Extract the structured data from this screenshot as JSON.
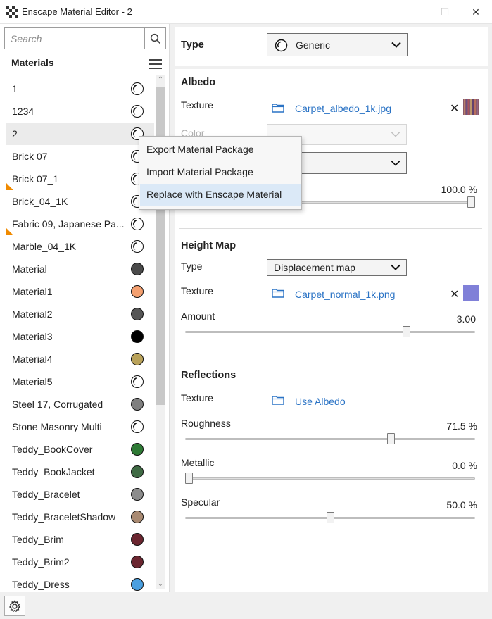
{
  "window": {
    "title": "Enscape Material Editor - 2",
    "minimize_glyph": "—",
    "maximize_glyph": "☐",
    "close_glyph": "✕"
  },
  "sidebar": {
    "search_placeholder": "Search",
    "header": "Materials",
    "items": [
      {
        "label": "1",
        "swatch": "generic"
      },
      {
        "label": "1234",
        "swatch": "generic"
      },
      {
        "label": "2",
        "swatch": "generic",
        "selected": true
      },
      {
        "label": "Brick 07",
        "swatch": "generic"
      },
      {
        "label": "Brick 07_1",
        "swatch": "generic",
        "warning": true
      },
      {
        "label": "Brick_04_1K",
        "swatch": "generic"
      },
      {
        "label": "Fabric 09, Japanese Pa...",
        "swatch": "generic",
        "warning": true
      },
      {
        "label": "Marble_04_1K",
        "swatch": "generic"
      },
      {
        "label": "Material",
        "swatch": "#4a4a4a"
      },
      {
        "label": "Material1",
        "swatch": "#f4a070"
      },
      {
        "label": "Material2",
        "swatch": "#555555"
      },
      {
        "label": "Material3",
        "swatch": "#000000"
      },
      {
        "label": "Material4",
        "swatch": "#b9a25a"
      },
      {
        "label": "Material5",
        "swatch": "generic"
      },
      {
        "label": "Steel 17, Corrugated",
        "swatch": "#7f7f7f"
      },
      {
        "label": "Stone Masonry Multi",
        "swatch": "generic"
      },
      {
        "label": "Teddy_BookCover",
        "swatch": "#2e7a35"
      },
      {
        "label": "Teddy_BookJacket",
        "swatch": "#3f6a44"
      },
      {
        "label": "Teddy_Bracelet",
        "swatch": "#8c8c8c"
      },
      {
        "label": "Teddy_BraceletShadow",
        "swatch": "#a98a72"
      },
      {
        "label": "Teddy_Brim",
        "swatch": "#6b2630"
      },
      {
        "label": "Teddy_Brim2",
        "swatch": "#6b2630"
      },
      {
        "label": "Teddy_Dress",
        "swatch": "#4a9fe0"
      }
    ]
  },
  "context_menu": {
    "items": [
      {
        "label": "Export Material Package"
      },
      {
        "label": "Import Material Package"
      },
      {
        "label": "Replace with Enscape Material",
        "hover": true
      }
    ]
  },
  "type_section": {
    "label": "Type",
    "value": "Generic"
  },
  "albedo": {
    "title": "Albedo",
    "texture_label": "Texture",
    "texture_file": "Carpet_albedo_1k.jpg",
    "color_label": "Color",
    "percent": "100.0 %",
    "percent_fraction": 1.0
  },
  "height_map": {
    "title": "Height Map",
    "type_label": "Type",
    "type_value": "Displacement map",
    "texture_label": "Texture",
    "texture_file": "Carpet_normal_1k.png",
    "amount_label": "Amount",
    "amount_value": "3.00",
    "amount_fraction": 0.77,
    "swatch_color": "#8080d8"
  },
  "reflections": {
    "title": "Reflections",
    "texture_label": "Texture",
    "texture_value": "Use Albedo",
    "roughness_label": "Roughness",
    "roughness_value": "71.5 %",
    "roughness_fraction": 0.715,
    "metallic_label": "Metallic",
    "metallic_value": "0.0 %",
    "metallic_fraction": 0.0,
    "specular_label": "Specular",
    "specular_value": "50.0 %",
    "specular_fraction": 0.5
  },
  "icons": {
    "app": "enscape-logo-icon",
    "search": "search-icon",
    "menu": "hamburger-icon",
    "folder": "folder-icon",
    "remove": "close-icon",
    "settings": "gear-icon",
    "chevron": "chevron-down-icon"
  },
  "colors": {
    "link": "#2a73c5",
    "warning": "#f08a00",
    "hover": "#dbe9f7"
  }
}
